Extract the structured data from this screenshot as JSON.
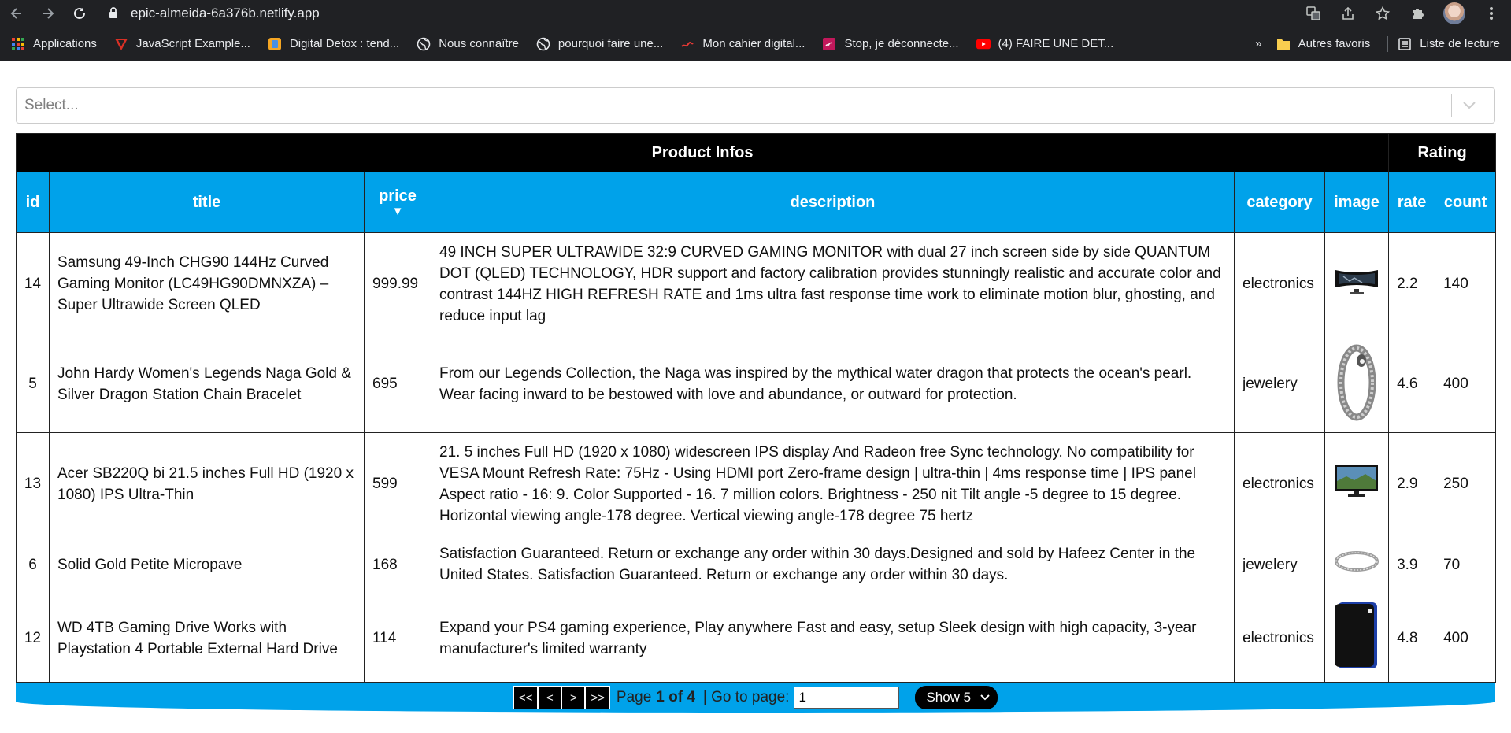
{
  "browser": {
    "url": "epic-almeida-6a376b.netlify.app",
    "bookmarks": [
      {
        "label": "Applications",
        "icon": "apps-grid-icon"
      },
      {
        "label": "JavaScript Example...",
        "icon": "javascript-red-icon"
      },
      {
        "label": "Digital Detox : tend...",
        "icon": "digital-detox-icon"
      },
      {
        "label": "Nous connaître",
        "icon": "globe-icon"
      },
      {
        "label": "pourquoi faire une...",
        "icon": "globe-icon"
      },
      {
        "label": "Mon cahier digital...",
        "icon": "notebook-icon"
      },
      {
        "label": "Stop, je déconnecte...",
        "icon": "stop-disconnect-icon"
      },
      {
        "label": "(4) FAIRE UNE DET...",
        "icon": "youtube-icon"
      }
    ],
    "overflow": "»",
    "other_favorites": "Autres favoris",
    "reading_list": "Liste de lecture"
  },
  "select": {
    "placeholder": "Select..."
  },
  "table": {
    "groups": {
      "product": "Product Infos",
      "rating": "Rating"
    },
    "columns": {
      "id": "id",
      "title": "title",
      "price": "price",
      "sort_indicator": "▼",
      "description": "description",
      "category": "category",
      "image": "image",
      "rate": "rate",
      "count": "count"
    },
    "rows": [
      {
        "id": "14",
        "title": "Samsung 49-Inch CHG90 144Hz Curved Gaming Monitor (LC49HG90DMNXZA) – Super Ultrawide Screen QLED",
        "price": "999.99",
        "description": "49 INCH SUPER ULTRAWIDE 32:9 CURVED GAMING MONITOR with dual 27 inch screen side by side QUANTUM DOT (QLED) TECHNOLOGY, HDR support and factory calibration provides stunningly realistic and accurate color and contrast 144HZ HIGH REFRESH RATE and 1ms ultra fast response time work to eliminate motion blur, ghosting, and reduce input lag",
        "category": "electronics",
        "image": "ultrawide-monitor-image",
        "rate": "2.2",
        "count": "140"
      },
      {
        "id": "5",
        "title": "John Hardy Women's Legends Naga Gold & Silver Dragon Station Chain Bracelet",
        "price": "695",
        "description": "From our Legends Collection, the Naga was inspired by the mythical water dragon that protects the ocean's pearl. Wear facing inward to be bestowed with love and abundance, or outward for protection.",
        "category": "jewelery",
        "image": "dragon-bracelet-image",
        "rate": "4.6",
        "count": "400"
      },
      {
        "id": "13",
        "title": "Acer SB220Q bi 21.5 inches Full HD (1920 x 1080) IPS Ultra-Thin",
        "price": "599",
        "description": "21. 5 inches Full HD (1920 x 1080) widescreen IPS display And Radeon free Sync technology. No compatibility for VESA Mount Refresh Rate: 75Hz - Using HDMI port Zero-frame design | ultra-thin | 4ms response time | IPS panel Aspect ratio - 16: 9. Color Supported - 16. 7 million colors. Brightness - 250 nit Tilt angle -5 degree to 15 degree. Horizontal viewing angle-178 degree. Vertical viewing angle-178 degree 75 hertz",
        "category": "electronics",
        "image": "acer-monitor-image",
        "rate": "2.9",
        "count": "250"
      },
      {
        "id": "6",
        "title": "Solid Gold Petite Micropave",
        "price": "168",
        "description": "Satisfaction Guaranteed. Return or exchange any order within 30 days.Designed and sold by Hafeez Center in the United States. Satisfaction Guaranteed. Return or exchange any order within 30 days.",
        "category": "jewelery",
        "image": "micropave-ring-image",
        "rate": "3.9",
        "count": "70"
      },
      {
        "id": "12",
        "title": "WD 4TB Gaming Drive Works with Playstation 4 Portable External Hard Drive",
        "price": "114",
        "description": "Expand your PS4 gaming experience, Play anywhere Fast and easy, setup Sleek design with high capacity, 3-year manufacturer's limited warranty",
        "category": "electronics",
        "image": "external-hard-drive-image",
        "rate": "4.8",
        "count": "400"
      }
    ]
  },
  "pagination": {
    "first": "<<",
    "prev": "<",
    "next": ">",
    "last": ">>",
    "page_label": "Page",
    "page_status": "1 of 4",
    "goto_label": "| Go to page:",
    "goto_value": "1",
    "show_label": "Show 5"
  }
}
